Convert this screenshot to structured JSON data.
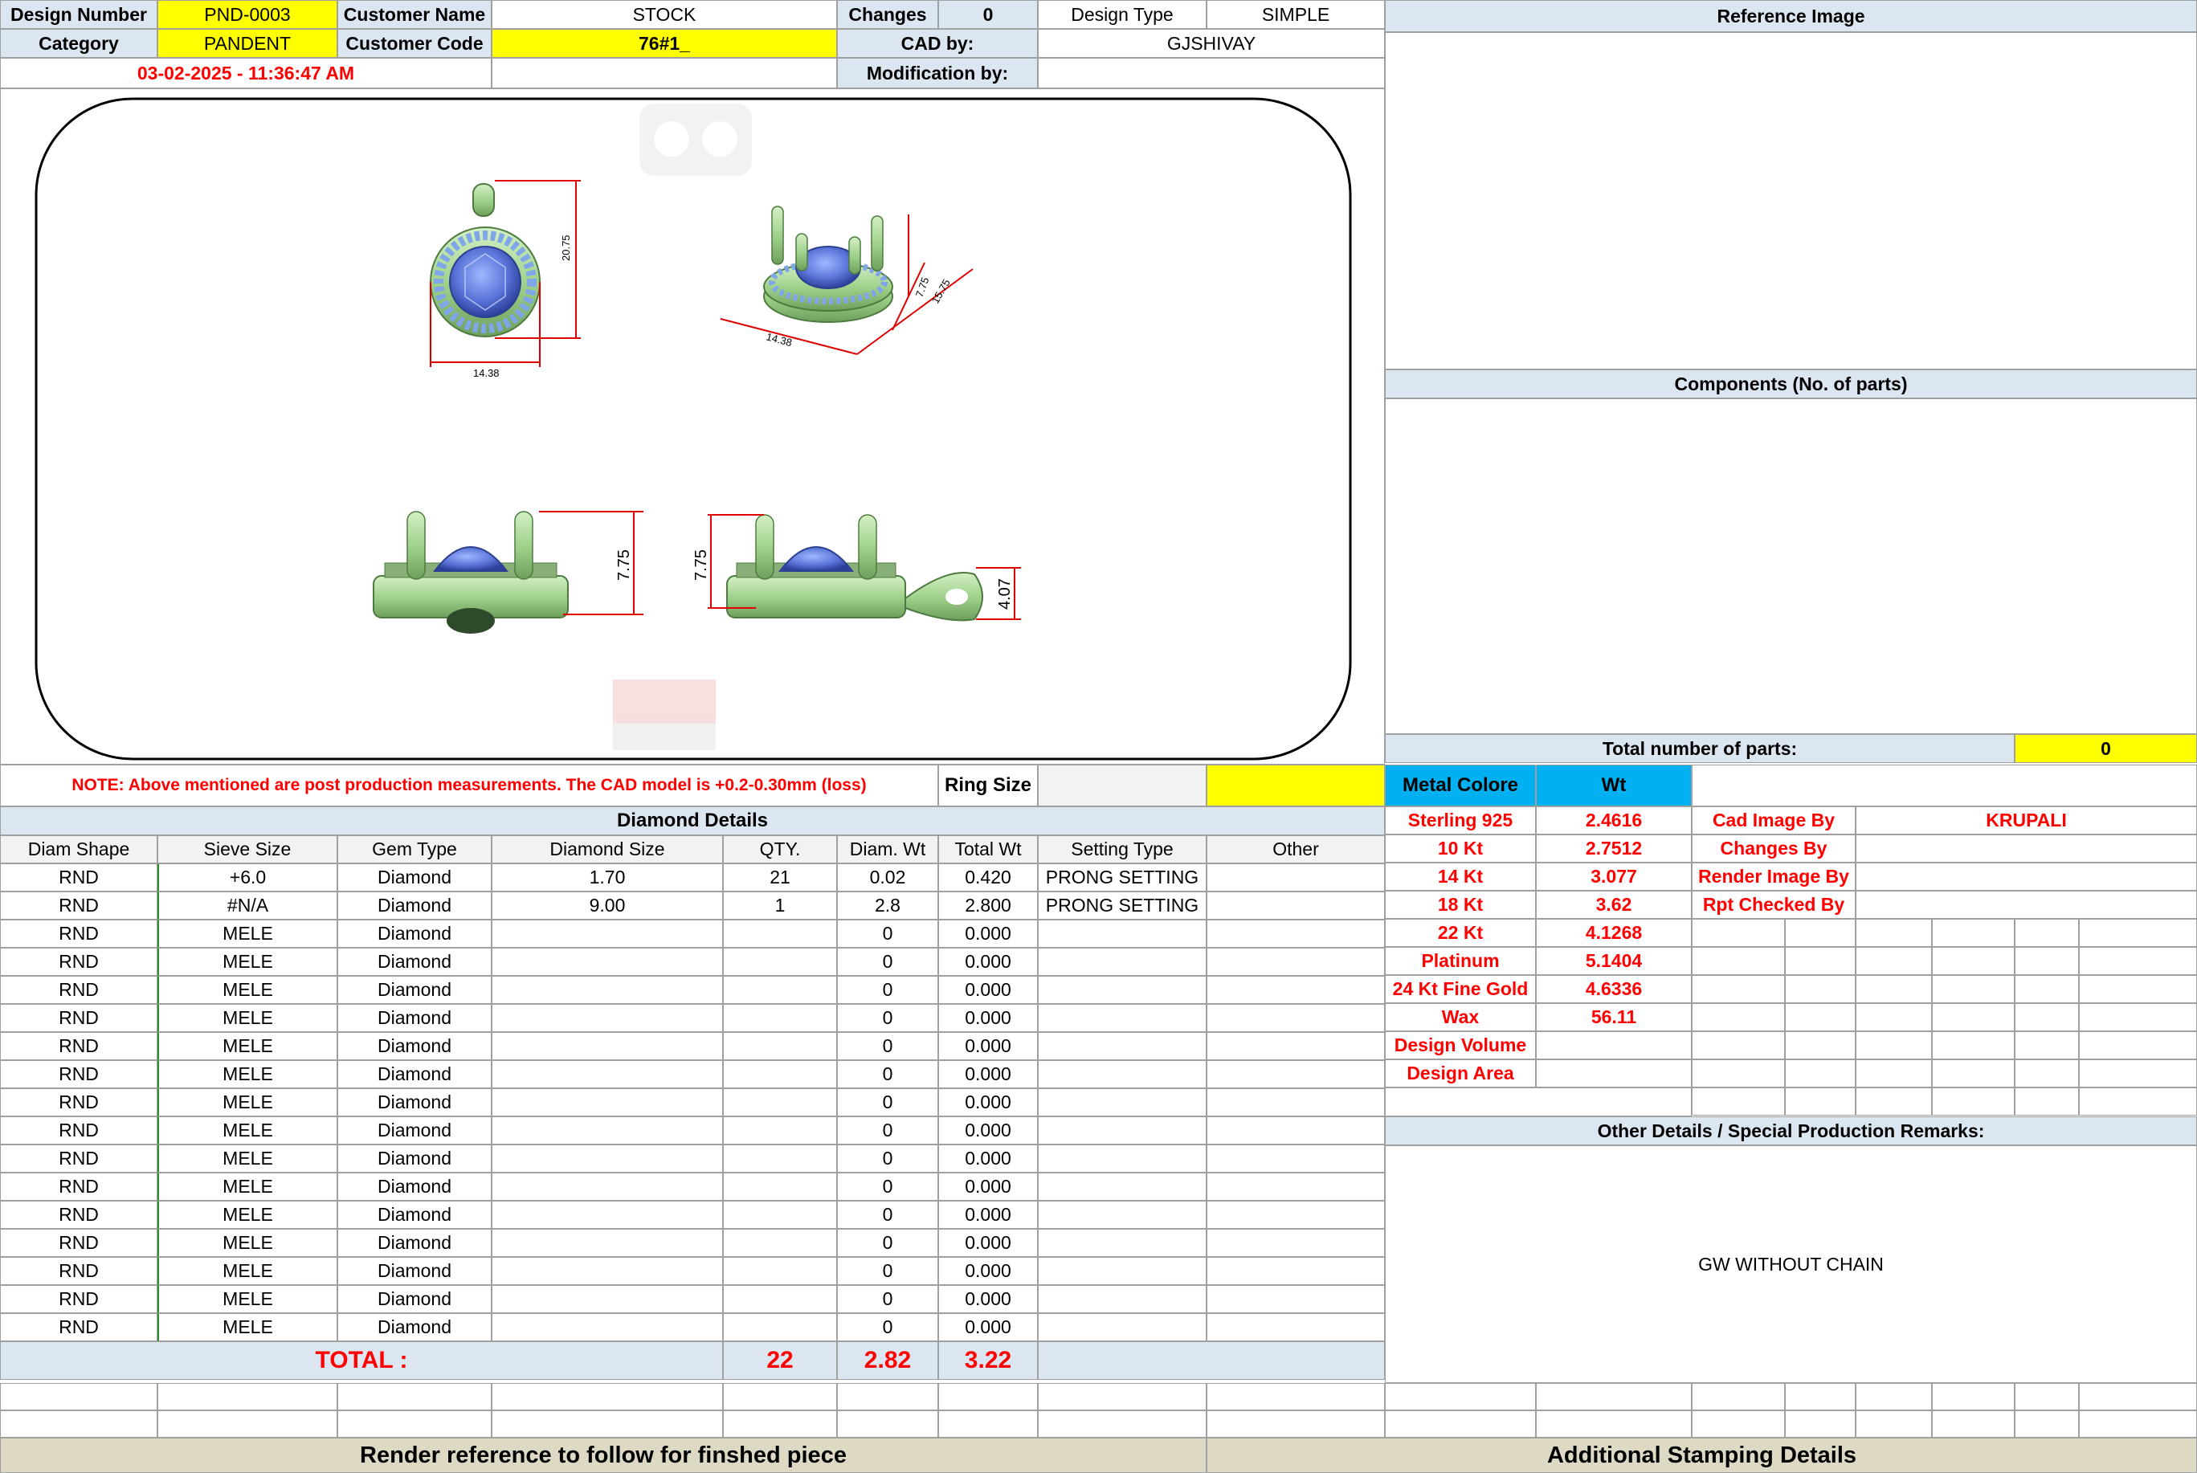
{
  "header": {
    "design_number_label": "Design Number",
    "design_number": "PND-0003",
    "customer_name_label": "Customer Name",
    "customer_name": "STOCK",
    "changes_label": "Changes",
    "changes": "0",
    "design_type_label": "Design Type",
    "design_type": "SIMPLE",
    "category_label": "Category",
    "category": "PANDENT",
    "customer_code_label": "Customer Code",
    "customer_code": "76#1_",
    "cad_by_label": "CAD by:",
    "cad_by": "GJSHIVAY",
    "timestamp": "03-02-2025 - 11:36:47 AM",
    "modification_by_label": "Modification by:",
    "modification_by": ""
  },
  "drawing": {
    "dim_front_height": "20.75",
    "dim_front_width": "14.38",
    "dim_iso_width": "14.38",
    "dim_iso_height": "7.75",
    "dim_iso_depth": "15.75",
    "dim_side_height": "7.75",
    "dim_back_height": "7.75",
    "dim_bail": "4.07"
  },
  "panels": {
    "reference_image": "Reference Image",
    "components": "Components (No. of parts)",
    "total_parts_label": "Total number of parts:",
    "total_parts": "0",
    "other_details": "Other Details / Special Production Remarks:",
    "remarks": "GW WITHOUT CHAIN"
  },
  "note": "NOTE: Above mentioned are post production measurements. The CAD model is +0.2-0.30mm (loss)",
  "ring_size_label": "Ring Size",
  "ring_size": "",
  "metal": {
    "header_color": "Metal Colore",
    "header_wt": "Wt",
    "rows": [
      {
        "name": "Sterling 925",
        "wt": "2.4616"
      },
      {
        "name": "10 Kt",
        "wt": "2.7512"
      },
      {
        "name": "14 Kt",
        "wt": "3.077"
      },
      {
        "name": "18 Kt",
        "wt": "3.62"
      },
      {
        "name": "22 Kt",
        "wt": "4.1268"
      },
      {
        "name": "Platinum",
        "wt": "5.1404"
      },
      {
        "name": "24 Kt Fine Gold",
        "wt": "4.6336"
      },
      {
        "name": "Wax",
        "wt": "56.11"
      },
      {
        "name": "Design Volume",
        "wt": ""
      },
      {
        "name": "Design Area",
        "wt": ""
      }
    ]
  },
  "credits": [
    {
      "label": "Cad Image By",
      "value": "KRUPALI"
    },
    {
      "label": "Changes By",
      "value": ""
    },
    {
      "label": "Render Image By",
      "value": ""
    },
    {
      "label": "Rpt Checked By",
      "value": ""
    }
  ],
  "diamond": {
    "title": "Diamond Details",
    "columns": [
      "Diam Shape",
      "Sieve Size",
      "Gem Type",
      "Diamond Size",
      "QTY.",
      "Diam. Wt",
      "Total Wt",
      "Setting Type",
      "Other"
    ],
    "rows": [
      [
        "RND",
        "+6.0",
        "Diamond",
        "1.70",
        "21",
        "0.02",
        "0.420",
        "PRONG SETTING",
        ""
      ],
      [
        "RND",
        "#N/A",
        "Diamond",
        "9.00",
        "1",
        "2.8",
        "2.800",
        "PRONG SETTING",
        ""
      ],
      [
        "RND",
        "MELE",
        "Diamond",
        "",
        "",
        "0",
        "0.000",
        "",
        ""
      ],
      [
        "RND",
        "MELE",
        "Diamond",
        "",
        "",
        "0",
        "0.000",
        "",
        ""
      ],
      [
        "RND",
        "MELE",
        "Diamond",
        "",
        "",
        "0",
        "0.000",
        "",
        ""
      ],
      [
        "RND",
        "MELE",
        "Diamond",
        "",
        "",
        "0",
        "0.000",
        "",
        ""
      ],
      [
        "RND",
        "MELE",
        "Diamond",
        "",
        "",
        "0",
        "0.000",
        "",
        ""
      ],
      [
        "RND",
        "MELE",
        "Diamond",
        "",
        "",
        "0",
        "0.000",
        "",
        ""
      ],
      [
        "RND",
        "MELE",
        "Diamond",
        "",
        "",
        "0",
        "0.000",
        "",
        ""
      ],
      [
        "RND",
        "MELE",
        "Diamond",
        "",
        "",
        "0",
        "0.000",
        "",
        ""
      ],
      [
        "RND",
        "MELE",
        "Diamond",
        "",
        "",
        "0",
        "0.000",
        "",
        ""
      ],
      [
        "RND",
        "MELE",
        "Diamond",
        "",
        "",
        "0",
        "0.000",
        "",
        ""
      ],
      [
        "RND",
        "MELE",
        "Diamond",
        "",
        "",
        "0",
        "0.000",
        "",
        ""
      ],
      [
        "RND",
        "MELE",
        "Diamond",
        "",
        "",
        "0",
        "0.000",
        "",
        ""
      ],
      [
        "RND",
        "MELE",
        "Diamond",
        "",
        "",
        "0",
        "0.000",
        "",
        ""
      ],
      [
        "RND",
        "MELE",
        "Diamond",
        "",
        "",
        "0",
        "0.000",
        "",
        ""
      ],
      [
        "RND",
        "MELE",
        "Diamond",
        "",
        "",
        "0",
        "0.000",
        "",
        ""
      ]
    ],
    "total_label": "TOTAL :",
    "total_qty": "22",
    "total_diam_wt": "2.82",
    "total_wt": "3.22"
  },
  "footer": {
    "render_ref": "Render reference to follow for finshed piece",
    "stamping": "Additional Stamping Details"
  }
}
